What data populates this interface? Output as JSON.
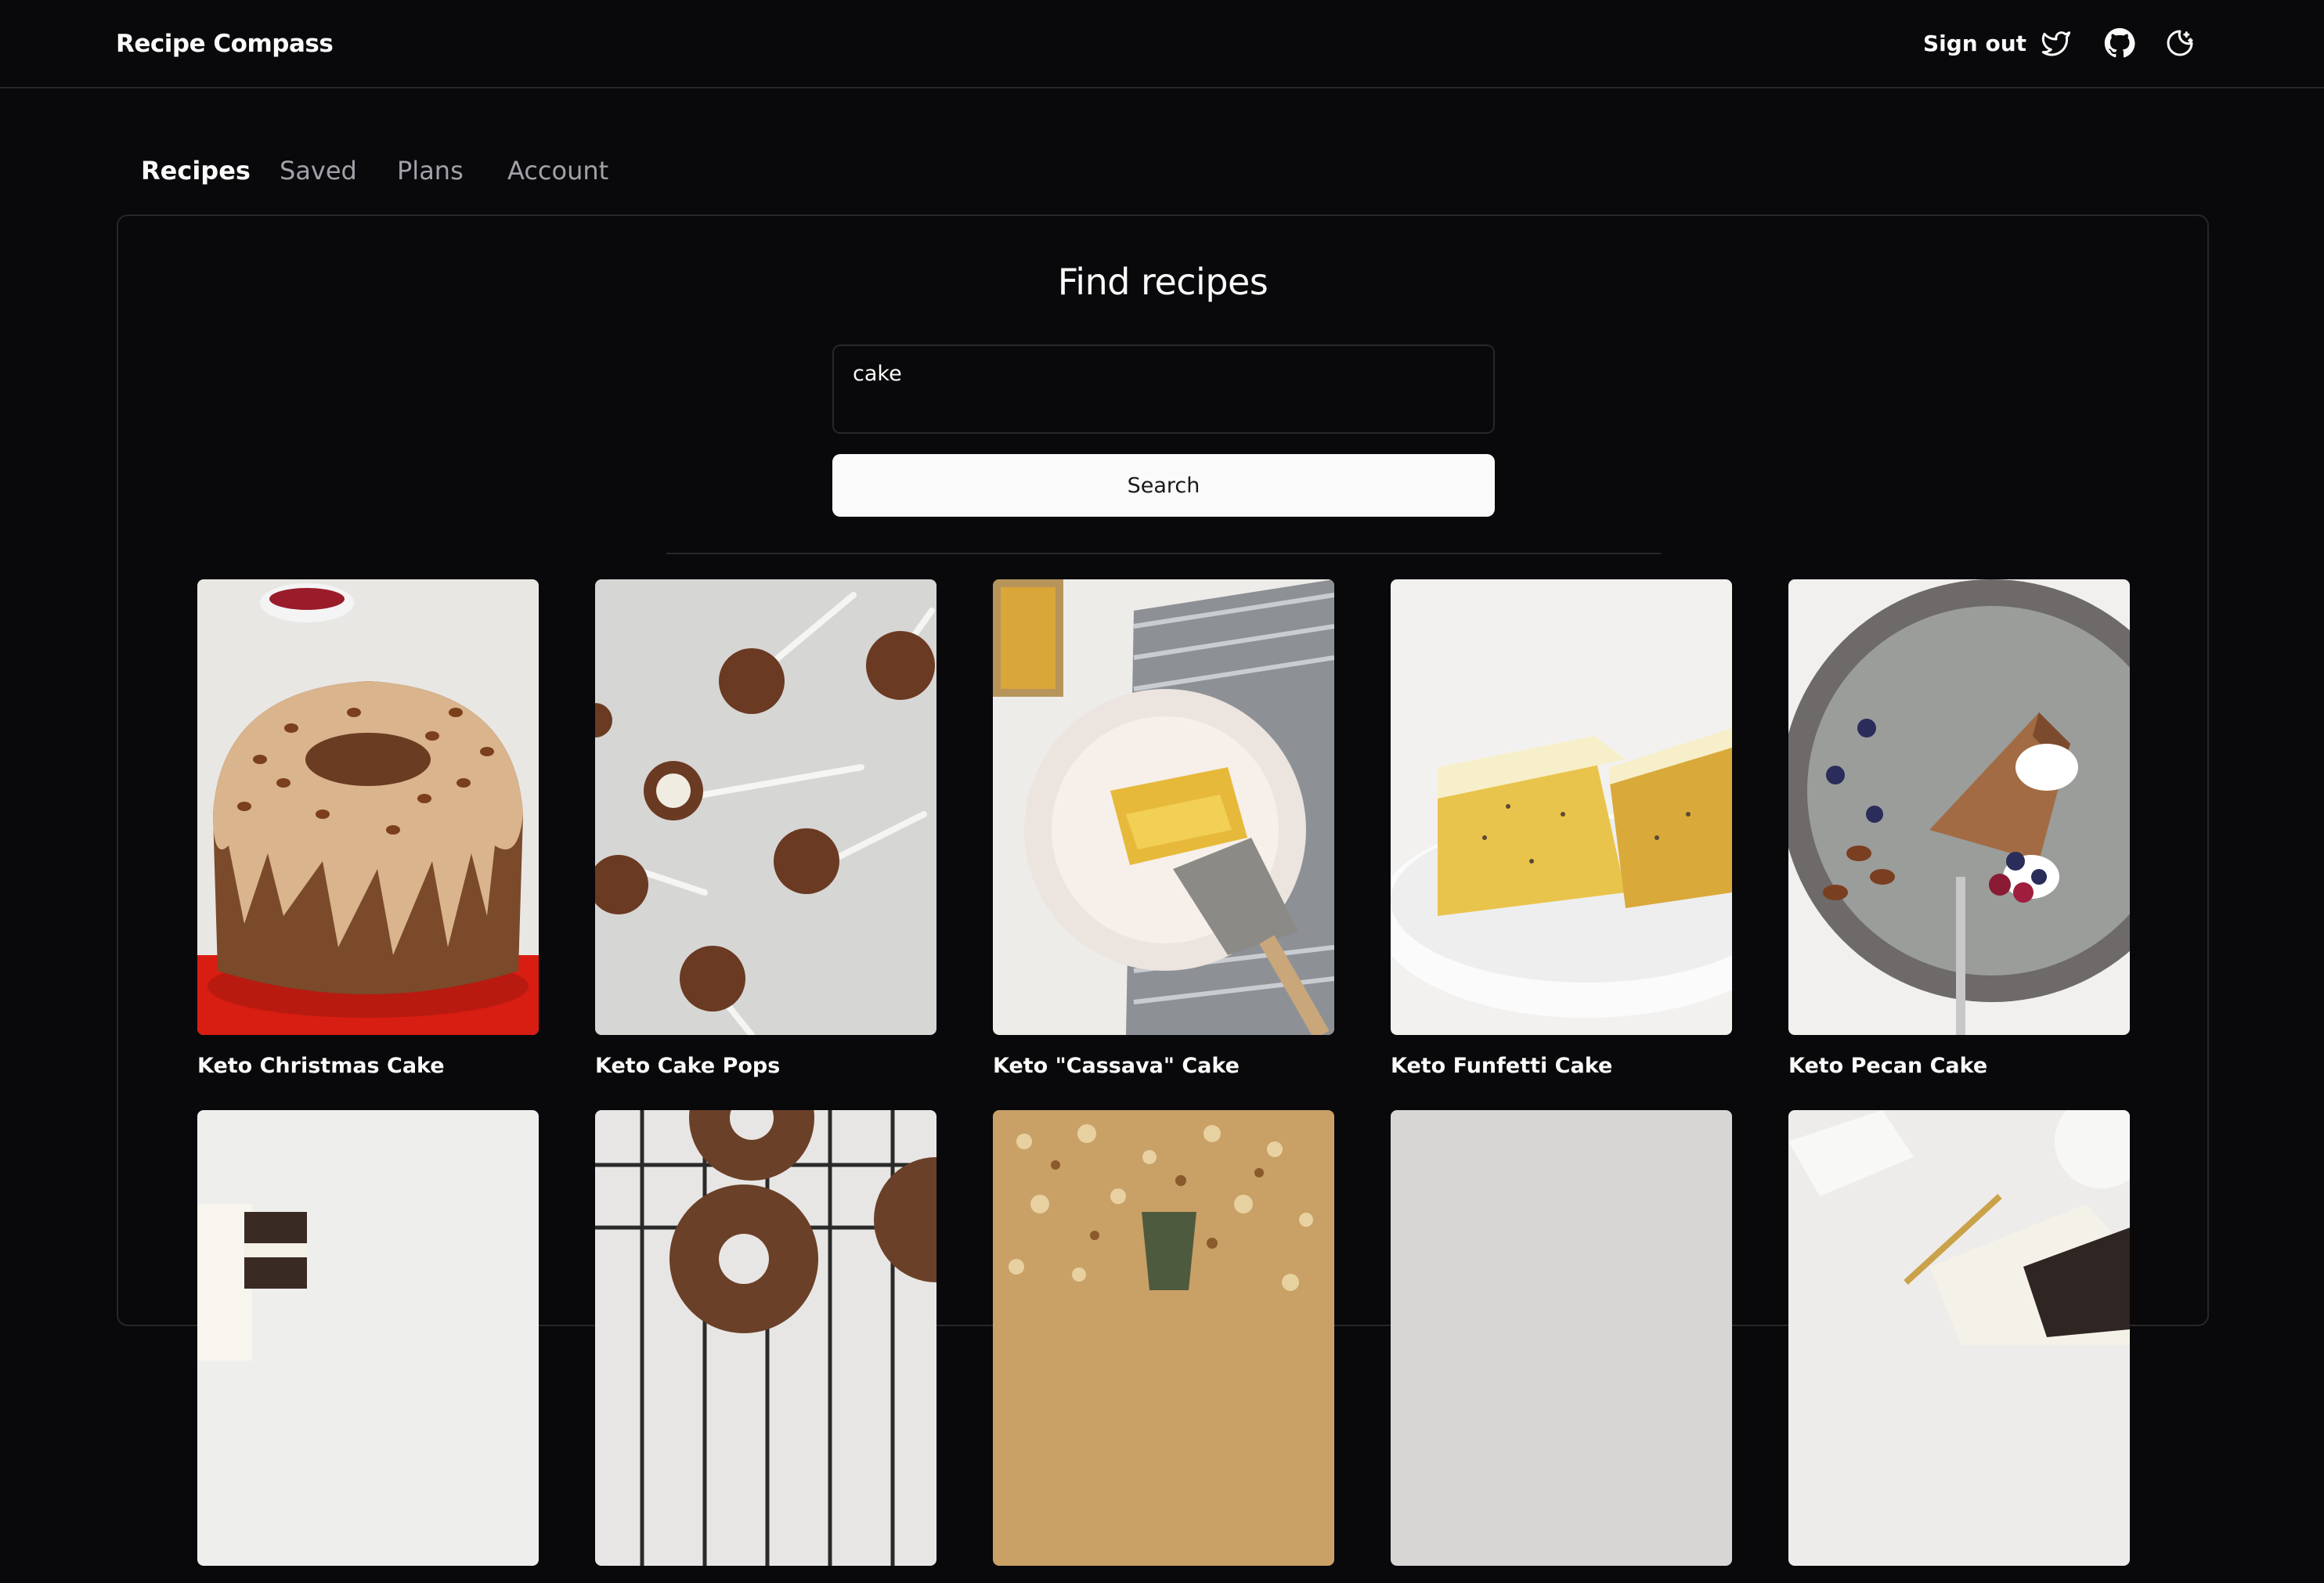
{
  "app": {
    "title": "Recipe Compass"
  },
  "header": {
    "sign_out_label": "Sign out",
    "icons": [
      "twitter-icon",
      "github-icon",
      "theme-toggle-icon"
    ]
  },
  "tabs": [
    {
      "label": "Recipes",
      "active": true
    },
    {
      "label": "Saved",
      "active": false
    },
    {
      "label": "Plans",
      "active": false
    },
    {
      "label": "Account",
      "active": false
    }
  ],
  "search": {
    "heading": "Find recipes",
    "value": "cake",
    "button_label": "Search"
  },
  "recipes": [
    {
      "title": "Keto Christmas Cake"
    },
    {
      "title": "Keto Cake Pops"
    },
    {
      "title": "Keto \"Cassava\" Cake"
    },
    {
      "title": "Keto Funfetti Cake"
    },
    {
      "title": "Keto Pecan Cake"
    },
    {
      "title": ""
    },
    {
      "title": ""
    },
    {
      "title": ""
    },
    {
      "title": ""
    },
    {
      "title": ""
    }
  ],
  "colors": {
    "background": "#09090b",
    "border": "#27272a",
    "text": "#fafafa",
    "muted_text": "#a1a1aa",
    "button_bg": "#fafafa",
    "button_text": "#18181b"
  }
}
